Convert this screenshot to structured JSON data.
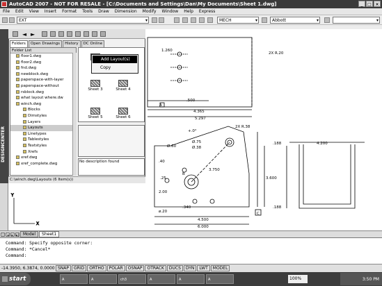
{
  "window": {
    "title": "AutoCAD 2007 - NOT FOR RESALE - [C:\\Documents and Settings\\Dan\\My Documents\\Sheet 1.dwg]"
  },
  "menu": [
    "File",
    "Edit",
    "View",
    "Insert",
    "Format",
    "Tools",
    "Draw",
    "Dimension",
    "Modify",
    "Window",
    "Help",
    "Express"
  ],
  "toolbar": {
    "layer_value": "EXT",
    "text_style": "MECH",
    "dim_style": "Abbott"
  },
  "design_center": {
    "side_label": "DESIGNCENTER",
    "tabs": [
      "Folders",
      "Open Drawings",
      "History",
      "DC Online"
    ],
    "tree_header": "Folder List",
    "tree_items": [
      "floor1.dwg",
      "floor2.dwg",
      "fnd.dwg",
      "newblock.dwg",
      "paperspace-with-layer",
      "paperspace-without",
      "rsblock.dwg",
      "what layout where.dw",
      "winch.dwg",
      "Blocks",
      "Dimstyles",
      "Layers",
      "Layouts",
      "Linetypes",
      "Tablestyles",
      "Textstyles",
      "Xrefs",
      "xref.dwg",
      "xref_complete.dwg"
    ],
    "thumbs": [
      "Sheet 3",
      "Sheet 4",
      "Sheet 5",
      "Sheet 6"
    ],
    "description": "No description found",
    "status": "C:\\winch.dwg\\Layouts (6 Item(s))"
  },
  "context_menu": {
    "items": [
      "Add Layout(s)",
      "Copy"
    ]
  },
  "drawing": {
    "dims": [
      "1.260",
      "2X R.20",
      ".500",
      "4.365",
      "5.297",
      "2X R.38",
      "+.0°",
      "Ø.60",
      "Ø.75",
      "Ø.38",
      ".40",
      ".25",
      "2.00",
      "3.750",
      "3.600",
      ".340",
      "ø.20",
      "4.500",
      "6.000",
      "4.200",
      ".188",
      ".188"
    ],
    "letters": [
      "A",
      "B",
      "C"
    ]
  },
  "layout_tabs": [
    "Model",
    "Sheet1"
  ],
  "command": {
    "line1": "Command: Specify opposite corner:",
    "line2": "Command: *Cancel*",
    "line3": "Command:"
  },
  "status": {
    "coords": "-14.3950, 6.3874, 0.0000",
    "buttons": [
      "SNAP",
      "GRID",
      "ORTHO",
      "POLAR",
      "OSNAP",
      "OTRACK",
      "DUCS",
      "DYN",
      "LWT",
      "MODEL"
    ]
  },
  "taskbar": {
    "start": "start",
    "items": [
      "A",
      "A",
      "ch3",
      "A",
      "A",
      "A"
    ],
    "zoom": "100%",
    "clock": "3:50 PM"
  }
}
